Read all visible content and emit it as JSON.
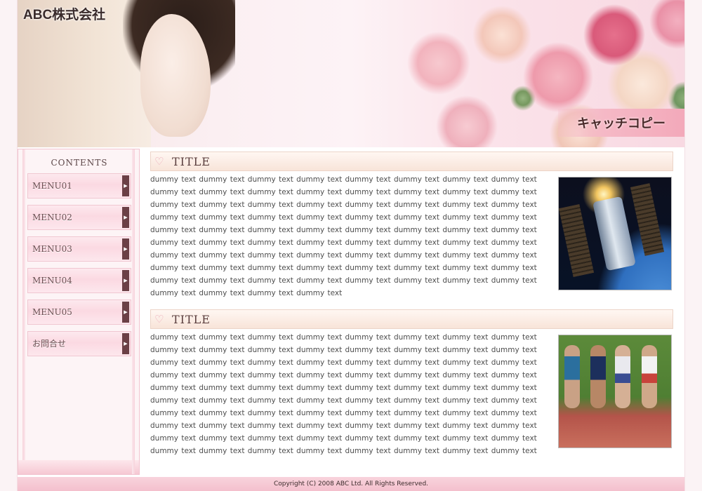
{
  "header": {
    "company_name": "ABC株式会社",
    "catch_copy": "キャッチコピー"
  },
  "sidebar": {
    "heading": "CONTENTS",
    "items": [
      {
        "label": "MENU01"
      },
      {
        "label": "MENU02"
      },
      {
        "label": "MENU03"
      },
      {
        "label": "MENU04"
      },
      {
        "label": "MENU05"
      },
      {
        "label": "お問合せ"
      }
    ]
  },
  "main": {
    "sections": [
      {
        "title": "TITLE",
        "body": "dummy text dummy text dummy text dummy text dummy text dummy text dummy text dummy text dummy text dummy text dummy text dummy text dummy text dummy text dummy text dummy text dummy text dummy text dummy text dummy text dummy text dummy text dummy text dummy text dummy text dummy text dummy text dummy text dummy text dummy text dummy text dummy text dummy text dummy text dummy text dummy text dummy text dummy text dummy text dummy text dummy text dummy text dummy text dummy text dummy text dummy text dummy text dummy text dummy text dummy text dummy text dummy text dummy text dummy text dummy text dummy text dummy text dummy text dummy text dummy text dummy text dummy text dummy text dummy text dummy text dummy text dummy text dummy text dummy text dummy text dummy text dummy text dummy text dummy text dummy text dummy text"
      },
      {
        "title": "TITLE",
        "body": "dummy text dummy text dummy text dummy text dummy text dummy text dummy text dummy text dummy text dummy text dummy text dummy text dummy text dummy text dummy text dummy text dummy text dummy text dummy text dummy text dummy text dummy text dummy text dummy text dummy text dummy text dummy text dummy text dummy text dummy text dummy text dummy text dummy text dummy text dummy text dummy text dummy text dummy text dummy text dummy text dummy text dummy text dummy text dummy text dummy text dummy text dummy text dummy text dummy text dummy text dummy text dummy text dummy text dummy text dummy text dummy text dummy text dummy text dummy text dummy text dummy text dummy text dummy text dummy text dummy text dummy text dummy text dummy text dummy text dummy text dummy text dummy text dummy text dummy text dummy text dummy text dummy text dummy text dummy text dummy text"
      }
    ]
  },
  "footer": {
    "copyright": "Copyright (C) 2008 ABC Ltd. All Rights Reserved."
  },
  "colors": {
    "accent_pink": "#f3a9ba",
    "menu_arrow": "#6b4046",
    "title_text": "#5a3e3e"
  },
  "icons": {
    "title_ornament": "heart-icon",
    "menu_arrow": "triangle-right-icon"
  }
}
